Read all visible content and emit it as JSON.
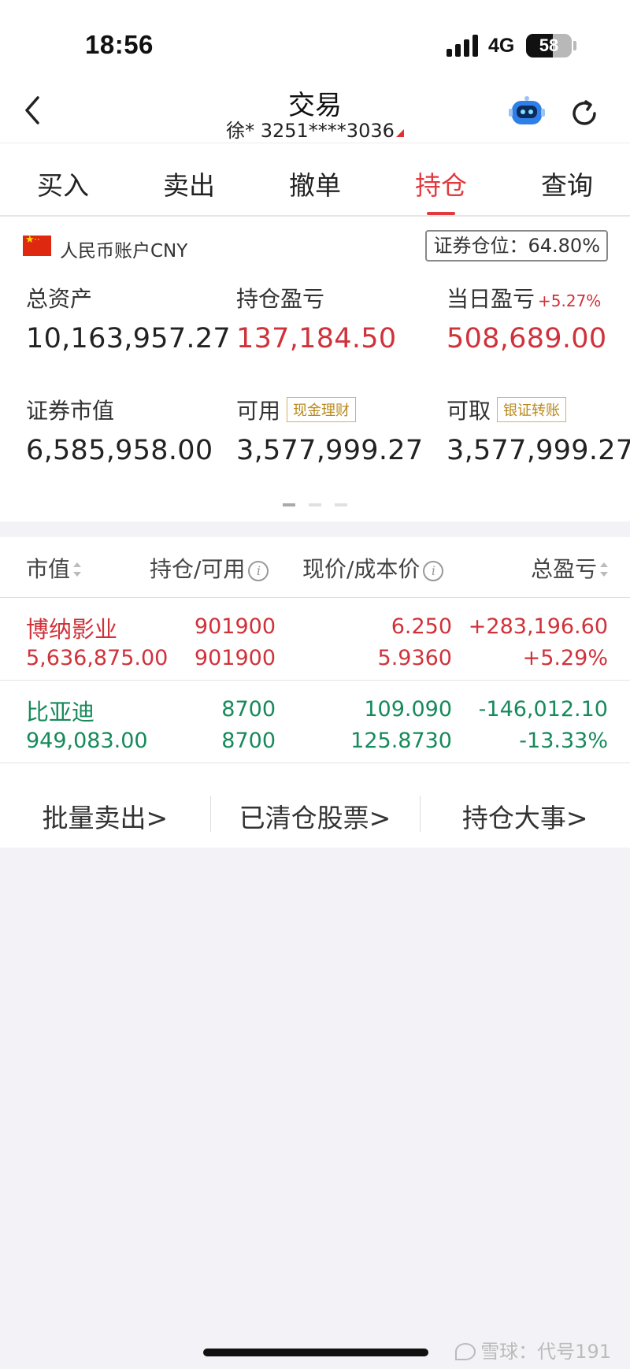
{
  "status_bar": {
    "time": "18:56",
    "network": "4G",
    "battery": "58",
    "battery_level": 0.58
  },
  "nav": {
    "title": "交易",
    "account": "徐* 3251****3036"
  },
  "tabs": [
    {
      "label": "买入",
      "active": false
    },
    {
      "label": "卖出",
      "active": false
    },
    {
      "label": "撤单",
      "active": false
    },
    {
      "label": "持仓",
      "active": true
    },
    {
      "label": "查询",
      "active": false
    }
  ],
  "account": {
    "label": "人民币账户CNY",
    "position_ratio": "证券仓位：64.80%",
    "summary": {
      "total_assets": {
        "label": "总资产",
        "value": "10,163,957.27"
      },
      "position_pnl": {
        "label": "持仓盈亏",
        "value": "137,184.50"
      },
      "daily_pnl": {
        "label": "当日盈亏",
        "pct": "+5.27%",
        "value": "508,689.00"
      },
      "market_value": {
        "label": "证券市值",
        "value": "6,585,958.00"
      },
      "available": {
        "label": "可用",
        "tag": "现金理财",
        "value": "3,577,999.27"
      },
      "withdrawable": {
        "label": "可取",
        "tag": "银证转账",
        "value": "3,577,999.27"
      }
    }
  },
  "table": {
    "headers": {
      "market_value": "市值",
      "position": "持仓/可用",
      "price": "现价/成本价",
      "total_pnl": "总盈亏"
    },
    "rows": [
      {
        "name": "博纳影业",
        "market_value": "5,636,875.00",
        "position": "901900",
        "available": "901900",
        "price": "6.250",
        "cost": "5.9360",
        "pnl": "+283,196.60",
        "pnl_pct": "+5.29%",
        "color": "#d0323a"
      },
      {
        "name": "比亚迪",
        "market_value": "949,083.00",
        "position": "8700",
        "available": "8700",
        "price": "109.090",
        "cost": "125.8730",
        "pnl": "-146,012.10",
        "pnl_pct": "-13.33%",
        "color": "#168a5b"
      }
    ]
  },
  "actions": [
    "批量卖出>",
    "已清仓股票>",
    "持仓大事>"
  ],
  "watermark": "雪球：代号191"
}
